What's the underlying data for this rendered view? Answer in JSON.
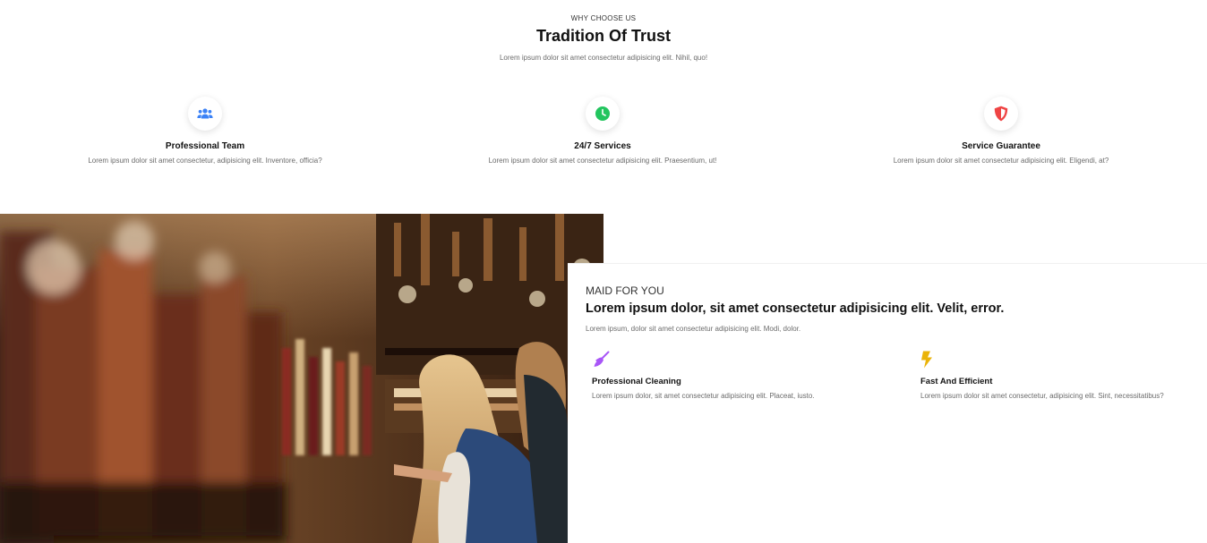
{
  "header": {
    "eyebrow": "WHY CHOOSE US",
    "title": "Tradition Of Trust",
    "subtitle": "Lorem ipsum dolor sit amet consectetur adipisicing elit. Nihil, quo!"
  },
  "features": [
    {
      "icon": "team-icon",
      "title": "Professional Team",
      "text": "Lorem ipsum dolor sit amet consectetur, adipisicing elit. Inventore, officia?",
      "color": "#3b82f6"
    },
    {
      "icon": "clock-icon",
      "title": "24/7 Services",
      "text": "Lorem ipsum dolor sit amet consectetur adipisicing elit. Praesentium, ut!",
      "color": "#22c55e"
    },
    {
      "icon": "shield-icon",
      "title": "Service Guarantee",
      "text": "Lorem ipsum dolor sit amet consectetur adipisicing elit. Eligendi, at?",
      "color": "#ef4444"
    }
  ],
  "maid": {
    "eyebrow": "MAID FOR YOU",
    "title": "Lorem ipsum dolor, sit amet consectetur adipisicing elit. Velit, error.",
    "subtitle": "Lorem ipsum, dolor sit amet consectetur adipisicing elit. Modi, dolor.",
    "items": [
      {
        "icon": "broom-icon",
        "title": "Professional Cleaning",
        "text": "Lorem ipsum dolor, sit amet consectetur adipisicing elit. Placeat, iusto.",
        "color": "#a855f7"
      },
      {
        "icon": "bolt-icon",
        "title": "Fast And Efficient",
        "text": "Lorem ipsum dolor sit amet consectetur, adipisicing elit. Sint, necessitatibus?",
        "color": "#eab308"
      }
    ]
  }
}
